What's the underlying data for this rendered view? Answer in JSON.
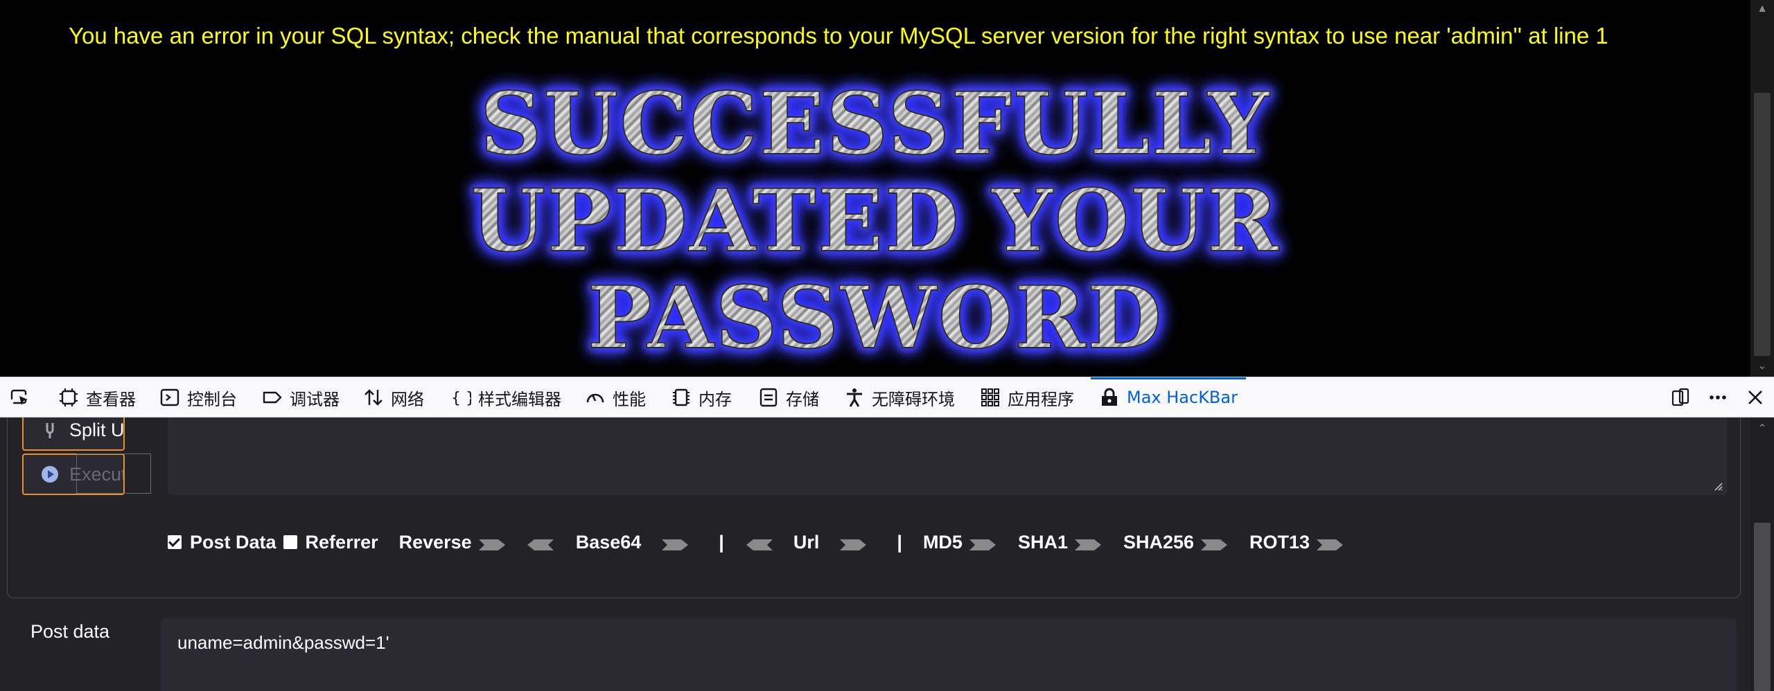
{
  "page": {
    "sql_error": "You have an error in your SQL syntax; check the manual that corresponds to your MySQL server version for the right syntax to use near 'admin'' at line 1",
    "banner_lines": [
      "SUCCESSFULLY",
      "UPDATED YOUR",
      "PASSWORD"
    ]
  },
  "devtools": {
    "tabs": [
      {
        "label": "查看器",
        "icon": "inspector-icon"
      },
      {
        "label": "控制台",
        "icon": "console-icon"
      },
      {
        "label": "调试器",
        "icon": "debugger-icon"
      },
      {
        "label": "网络",
        "icon": "network-icon"
      },
      {
        "label": "样式编辑器",
        "icon": "style-editor-icon"
      },
      {
        "label": "性能",
        "icon": "performance-icon"
      },
      {
        "label": "内存",
        "icon": "memory-icon"
      },
      {
        "label": "存储",
        "icon": "storage-icon"
      },
      {
        "label": "无障碍环境",
        "icon": "accessibility-icon"
      },
      {
        "label": "应用程序",
        "icon": "application-icon"
      },
      {
        "label": "Max HacKBar",
        "icon": "hackbar-lock-icon"
      }
    ],
    "active_tab": "Max HacKBar",
    "accent_color": "#0061e0"
  },
  "hackbar": {
    "split_url_label": "Split URL",
    "execution_label": "Execution",
    "post_data_checked": true,
    "post_data_label": "Post Data",
    "referrer_checked": false,
    "referrer_label": "Referrer",
    "reverse_label": "Reverse",
    "base64_label": "Base64",
    "separator": "|",
    "url_label": "Url",
    "md5_label": "MD5",
    "sha1_label": "SHA1",
    "sha256_label": "SHA256",
    "rot13_label": "ROT13",
    "post_data_field_label": "Post data",
    "post_data_value": "uname=admin&passwd=1'",
    "button_border_color": "#e8902b"
  },
  "colors": {
    "error_text": "#ffff00",
    "banner_glow": "#1717ff"
  }
}
